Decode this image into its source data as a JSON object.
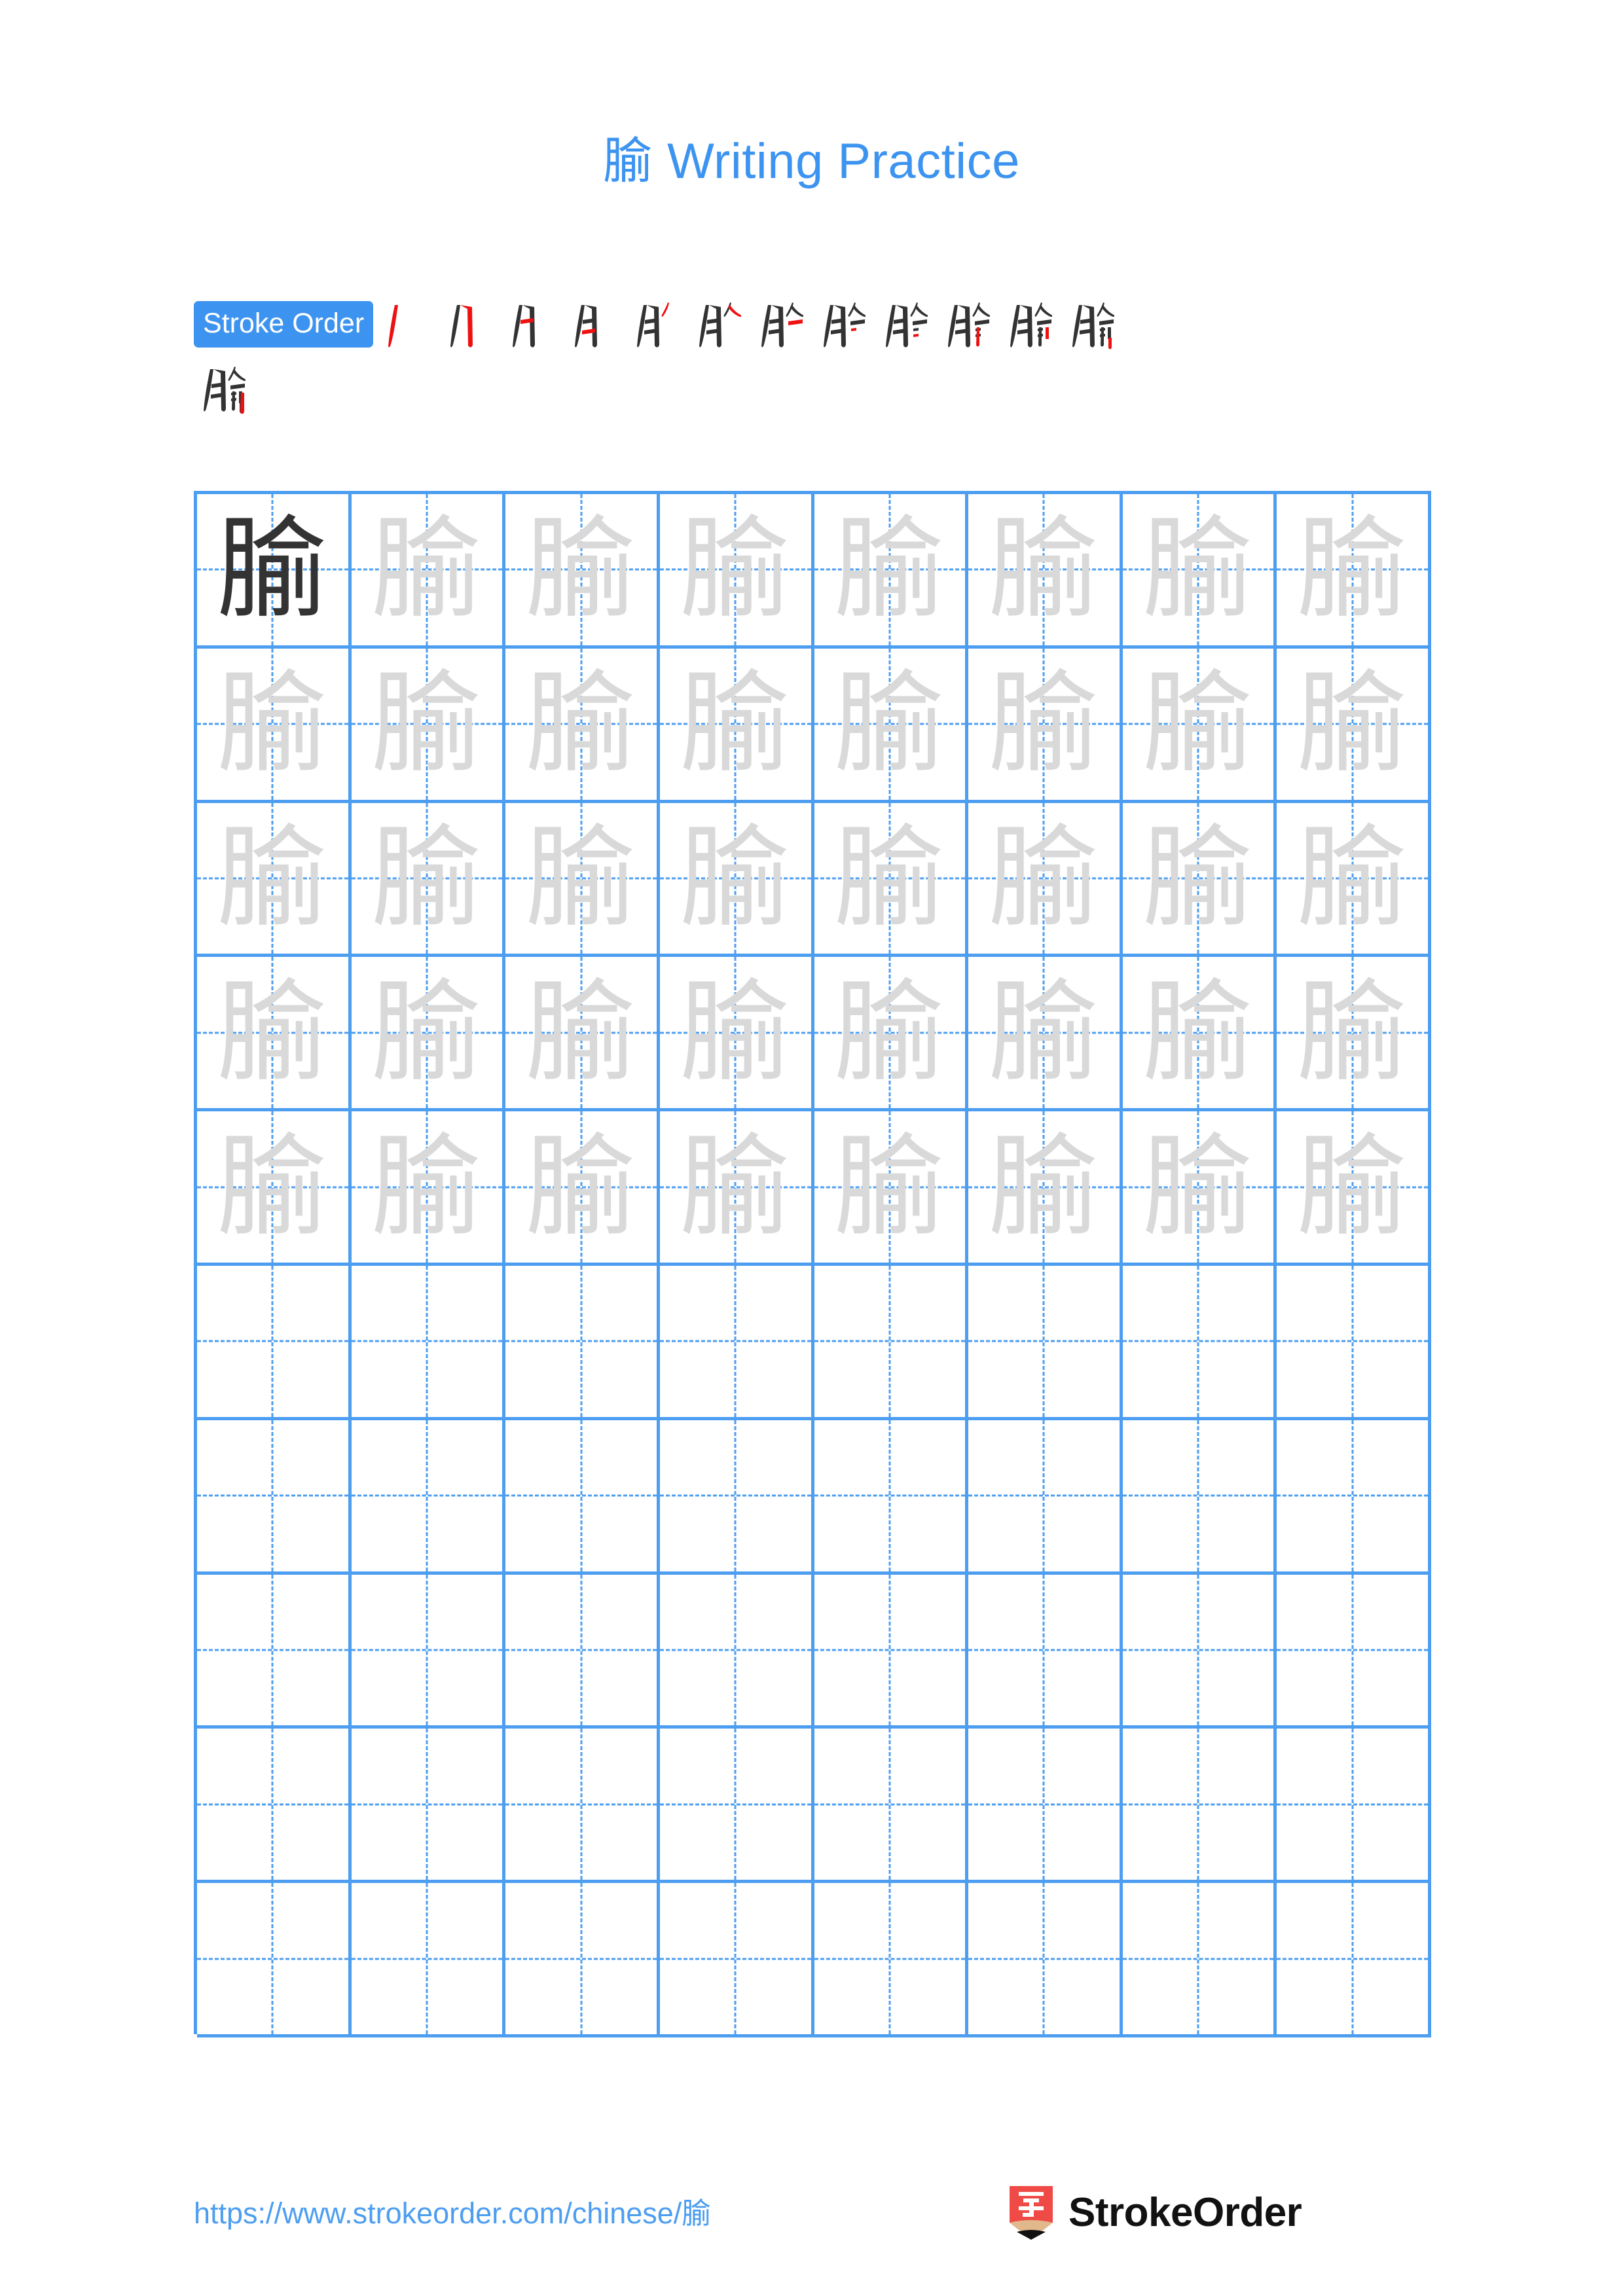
{
  "character": "腧",
  "title": "腧 Writing Practice",
  "colors": {
    "title_blue": "#3d94f0",
    "grid_blue": "#4d9ef0",
    "badge_blue": "#3d94f0",
    "model_char": "#333333",
    "trace_char": "#d9d9d9",
    "stroke_done": "#333333",
    "stroke_current": "#ee1111",
    "logo_red": "#ef4a45",
    "logo_wood": "#e0b88c"
  },
  "stroke_order": {
    "badge_label": "Stroke Order",
    "total_strokes": 13,
    "steps": [
      {
        "index": 1,
        "partial": "丿"
      },
      {
        "index": 2,
        "partial": "冂"
      },
      {
        "index": 3,
        "partial": "月"
      },
      {
        "index": 4,
        "partial": "月"
      },
      {
        "index": 5,
        "partial": "月丿"
      },
      {
        "index": 6,
        "partial": "月𠆢"
      },
      {
        "index": 7,
        "partial": "月𠆢"
      },
      {
        "index": 8,
        "partial": "胢"
      },
      {
        "index": 9,
        "partial": "腧"
      },
      {
        "index": 10,
        "partial": "腧"
      },
      {
        "index": 11,
        "partial": "腧"
      },
      {
        "index": 12,
        "partial": "腧"
      },
      {
        "index": 13,
        "partial": "腧"
      }
    ]
  },
  "practice_grid": {
    "columns": 8,
    "rows": 10,
    "filled_rows": 5,
    "empty_rows": 5,
    "model_cell": {
      "row": 1,
      "col": 1,
      "char": "腧"
    },
    "trace_char": "腧"
  },
  "footer": {
    "url": "https://www.strokeorder.com/chinese/腧",
    "brand_name": "StrokeOrder",
    "logo_glyph": "字"
  }
}
